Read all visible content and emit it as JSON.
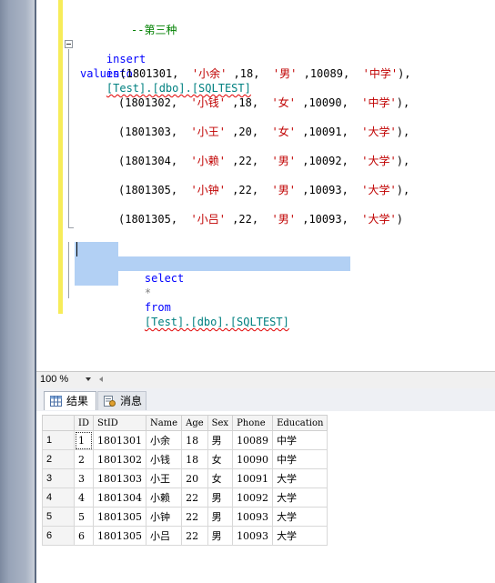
{
  "editor": {
    "comment": "--第三种",
    "insert_kw": "insert",
    "into_kw": "into",
    "insert_target": "[Test].[dbo].[SQLTEST]",
    "values_kw": "values",
    "rows": [
      {
        "open": "(",
        "id": "1801301",
        "name": "'小余'",
        "age": "18",
        "sex": "'男'",
        "phone": "10089",
        "edu": "'中学'",
        "close": "),"
      },
      {
        "open": "(",
        "id": "1801302",
        "name": "'小钱'",
        "age": "18",
        "sex": "'女'",
        "phone": "10090",
        "edu": "'中学'",
        "close": "),"
      },
      {
        "open": "(",
        "id": "1801303",
        "name": "'小王'",
        "age": "20",
        "sex": "'女'",
        "phone": "10091",
        "edu": "'大学'",
        "close": "),"
      },
      {
        "open": "(",
        "id": "1801304",
        "name": "'小赖'",
        "age": "22",
        "sex": "'男'",
        "phone": "10092",
        "edu": "'大学'",
        "close": "),"
      },
      {
        "open": "(",
        "id": "1801305",
        "name": "'小钟'",
        "age": "22",
        "sex": "'男'",
        "phone": "10093",
        "edu": "'大学'",
        "close": "),"
      },
      {
        "open": "(",
        "id": "1801305",
        "name": "'小吕'",
        "age": "22",
        "sex": "'男'",
        "phone": "10093",
        "edu": "'大学'",
        "close": ")"
      }
    ],
    "select_kw": "select",
    "star": "*",
    "from_kw": "from",
    "select_target": "[Test].[dbo].[SQLTEST]"
  },
  "statusbar": {
    "zoom": "100 %"
  },
  "tabs": [
    {
      "label": "结果",
      "icon": "grid-icon",
      "active": true
    },
    {
      "label": "消息",
      "icon": "messages-icon",
      "active": false
    }
  ],
  "results": {
    "columns": [
      "ID",
      "StID",
      "Name",
      "Age",
      "Sex",
      "Phone",
      "Education"
    ],
    "rows": [
      {
        "num": "1",
        "cells": [
          "1",
          "1801301",
          "小余",
          "18",
          "男",
          "10089",
          "中学"
        ]
      },
      {
        "num": "2",
        "cells": [
          "2",
          "1801302",
          "小钱",
          "18",
          "女",
          "10090",
          "中学"
        ]
      },
      {
        "num": "3",
        "cells": [
          "3",
          "1801303",
          "小王",
          "20",
          "女",
          "10091",
          "大学"
        ]
      },
      {
        "num": "4",
        "cells": [
          "4",
          "1801304",
          "小赖",
          "22",
          "男",
          "10092",
          "大学"
        ]
      },
      {
        "num": "5",
        "cells": [
          "5",
          "1801305",
          "小钟",
          "22",
          "男",
          "10093",
          "大学"
        ]
      },
      {
        "num": "6",
        "cells": [
          "6",
          "1801305",
          "小吕",
          "22",
          "男",
          "10093",
          "大学"
        ]
      }
    ]
  },
  "colors": {
    "keyword": "#0000ff",
    "comment": "#008000",
    "string": "#c00000",
    "object": "#008080",
    "selection": "#b2d0f4"
  }
}
